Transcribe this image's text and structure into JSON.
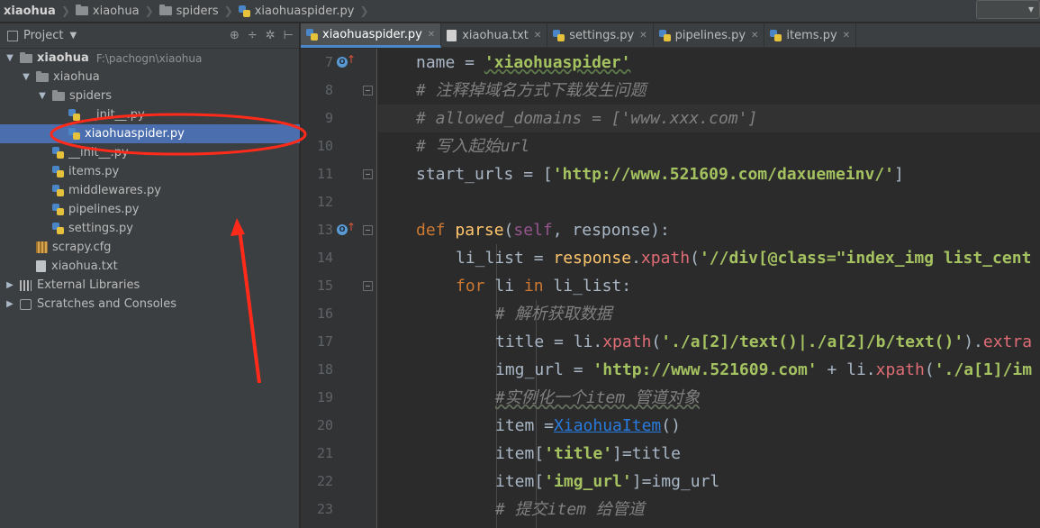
{
  "breadcrumb": {
    "root": "xiaohua",
    "folder1": "xiaohua",
    "folder2": "spiders",
    "file": "xiaohuaspider.py"
  },
  "project_panel": {
    "title": "Project",
    "tree": [
      {
        "label": "xiaohua",
        "path": "F:\\pachogn\\xiaohua",
        "icon": "folder-icon"
      },
      {
        "label": "xiaohua",
        "icon": "folder-icon"
      },
      {
        "label": "spiders",
        "icon": "folder-icon"
      },
      {
        "label": "__init__.py",
        "icon": "python-file-icon"
      },
      {
        "label": "xiaohuaspider.py",
        "icon": "python-file-icon"
      },
      {
        "label": "__init__.py",
        "icon": "python-file-icon"
      },
      {
        "label": "items.py",
        "icon": "python-file-icon"
      },
      {
        "label": "middlewares.py",
        "icon": "python-file-icon"
      },
      {
        "label": "pipelines.py",
        "icon": "python-file-icon"
      },
      {
        "label": "settings.py",
        "icon": "python-file-icon"
      },
      {
        "label": "scrapy.cfg",
        "icon": "config-file-icon"
      },
      {
        "label": "xiaohua.txt",
        "icon": "text-file-icon"
      },
      {
        "label": "External Libraries",
        "icon": "library-icon"
      },
      {
        "label": "Scratches and Consoles",
        "icon": "scratches-icon"
      }
    ]
  },
  "tabs": [
    {
      "label": "xiaohuaspider.py",
      "active": true
    },
    {
      "label": "xiaohua.txt",
      "active": false
    },
    {
      "label": "settings.py",
      "active": false
    },
    {
      "label": "pipelines.py",
      "active": false
    },
    {
      "label": "items.py",
      "active": false
    }
  ],
  "editor": {
    "line_numbers": [
      "7",
      "8",
      "9",
      "10",
      "11",
      "12",
      "13",
      "14",
      "15",
      "16",
      "17",
      "18",
      "19",
      "20",
      "21",
      "22",
      "23"
    ],
    "code": {
      "l7_a": "name = ",
      "l7_b": "'xiaohuaspider'",
      "l8": "# 注释掉域名方式下载发生问题",
      "l9": "# allowed_domains = ['www.xxx.com']",
      "l10": "# 写入起始url",
      "l11_a": "start_urls = [",
      "l11_b": "'http://www.521609.com/daxuemeinv/'",
      "l11_c": "]",
      "l13_a": "def ",
      "l13_b": "parse",
      "l13_c": "(",
      "l13_d": "self",
      "l13_e": ", response):",
      "l14_a": "li_list = ",
      "l14_b": "response",
      "l14_c": ".",
      "l14_d": "xpath",
      "l14_e": "(",
      "l14_f": "'//div[@class=\"index_img list_cent",
      "l15_a": "for ",
      "l15_b": "li ",
      "l15_c": "in ",
      "l15_d": "li_list:",
      "l16": "# 解析获取数据",
      "l17_a": "title = li.",
      "l17_b": "xpath",
      "l17_c": "(",
      "l17_d": "'./a[2]/text()|./a[2]/b/text()'",
      "l17_e": ").",
      "l17_f": "extra",
      "l18_a": "img_url = ",
      "l18_b": "'http://www.521609.com'",
      "l18_c": " + li.",
      "l18_d": "xpath",
      "l18_e": "(",
      "l18_f": "'./a[1]/im",
      "l19": "#实例化一个item 管道对象",
      "l20_a": "item =",
      "l20_b": "XiaohuaItem",
      "l20_c": "()",
      "l21_a": "item[",
      "l21_b": "'title'",
      "l21_c": "]=title",
      "l22_a": "item[",
      "l22_b": "'img_url'",
      "l22_c": "]=img_url",
      "l23": "# 提交item 给管道"
    }
  },
  "colors": {
    "annotation": "#ff2a1a",
    "selection": "#4b6eaf",
    "keyword": "#cc7832",
    "string": "#6a8759",
    "comment": "#808080"
  }
}
